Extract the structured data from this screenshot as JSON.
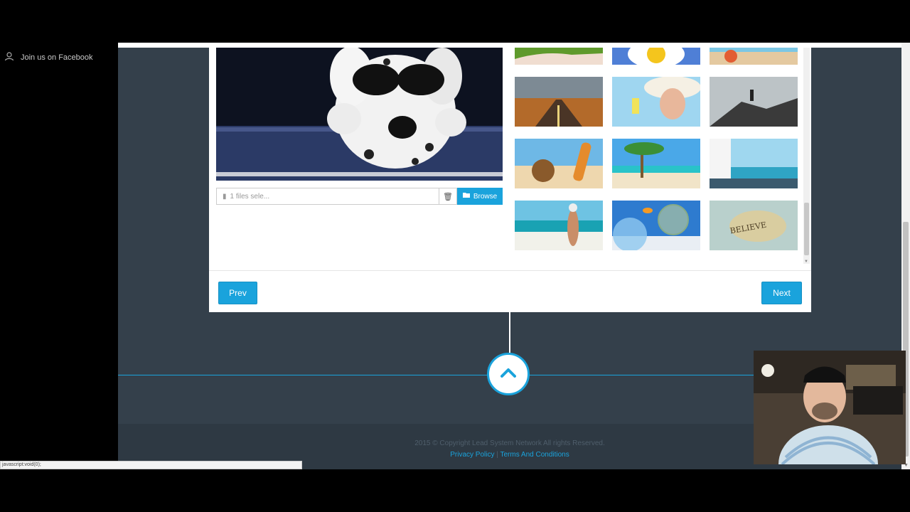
{
  "sidebar": {
    "facebook_label": "Join us on Facebook"
  },
  "uploader": {
    "file_placeholder": "1 files sele...",
    "browse_label": "Browse"
  },
  "gallery": {
    "images": [
      "legs-on-grass",
      "daisy-flower",
      "beach-sand-toy",
      "desert-road",
      "woman-with-drink",
      "hiker-on-summit",
      "coconut-flip-flops",
      "palm-tree-beach",
      "window-sea-view",
      "woman-walking-beach",
      "goldfish-jumping-bowl",
      "believe-stone"
    ]
  },
  "nav": {
    "prev_label": "Prev",
    "next_label": "Next"
  },
  "footer": {
    "copyright": "2015 © Copyright Lead System Network All rights Reserved.",
    "privacy_label": "Privacy Policy",
    "separator": " | ",
    "terms_label": "Terms And Conditions"
  },
  "status_bar": {
    "text": "javascript:void(0);"
  },
  "colors": {
    "accent": "#1aa3dc",
    "page_bg": "#34404b",
    "footer_bg": "#2e3943"
  }
}
